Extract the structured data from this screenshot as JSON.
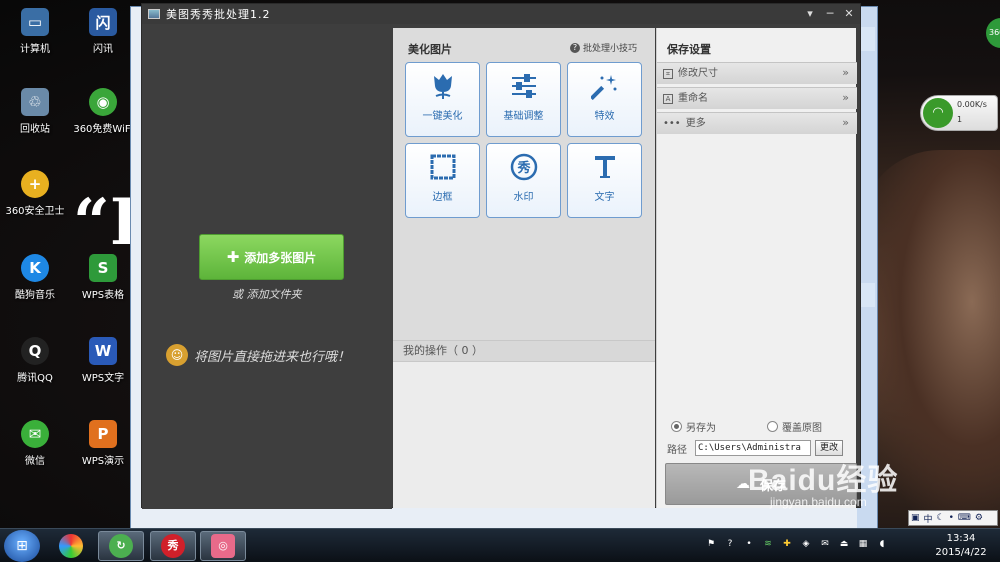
{
  "desktop": {
    "icons": [
      {
        "label": "计算机",
        "glyph": "▭",
        "color": "#3a6ea5"
      },
      {
        "label": "闪讯",
        "glyph": "闪",
        "color": "#2a5aa0"
      },
      {
        "label": "回收站",
        "glyph": "♲",
        "color": "#6a8aa8"
      },
      {
        "label": "360免费WiFi",
        "glyph": "◉",
        "color": "#3aa63a"
      },
      {
        "label": "360安全卫士",
        "glyph": "+",
        "color": "#e8b020"
      },
      {
        "label": "酷狗音乐",
        "glyph": "K",
        "color": "#1e88e5"
      },
      {
        "label": "WPS表格",
        "glyph": "S",
        "color": "#2e9a3a"
      },
      {
        "label": "腾讯QQ",
        "glyph": "Q",
        "color": "#222222"
      },
      {
        "label": "WPS文字",
        "glyph": "W",
        "color": "#2a5ab8"
      },
      {
        "label": "微信",
        "glyph": "✉",
        "color": "#3ab03a"
      },
      {
        "label": "WPS演示",
        "glyph": "P",
        "color": "#e0701e"
      }
    ],
    "quote_glyph": "“I"
  },
  "app": {
    "title": "美图秀秀批处理1.2",
    "window_buttons": [
      "▾",
      "─",
      "✕"
    ],
    "left": {
      "add_button": "添加多张图片",
      "add_folder": "或 添加文件夹",
      "drag_tip": "将图片直接拖进来也行哦！"
    },
    "middle": {
      "heading": "美化图片",
      "tips": "批处理小技巧",
      "tools": [
        {
          "label": "一键美化",
          "icon": "tulip-icon"
        },
        {
          "label": "基础调整",
          "icon": "sliders-icon"
        },
        {
          "label": "特效",
          "icon": "magic-wand-icon"
        },
        {
          "label": "边框",
          "icon": "frame-icon"
        },
        {
          "label": "水印",
          "icon": "watermark-icon"
        },
        {
          "label": "文字",
          "icon": "text-icon"
        }
      ],
      "ops_label": "我的操作（ 0 ）"
    },
    "right": {
      "heading": "保存设置",
      "sections": [
        "修改尺寸",
        "重命名",
        "更多"
      ],
      "radio_save_as": "另存为",
      "radio_overwrite": "覆盖原图",
      "path_label": "路径",
      "path_value": "C:\\Users\\Administra",
      "change_button": "更改",
      "save_button": "保存"
    }
  },
  "watermark": {
    "text": "Baidu经验",
    "url": "jingyan.baidu.com"
  },
  "net_widget": {
    "speed": "0.00K/s",
    "count": "1"
  },
  "corner_badge": "360",
  "taskbar": {
    "ime": "中",
    "time": "13:34",
    "date": "2015/4/22"
  }
}
